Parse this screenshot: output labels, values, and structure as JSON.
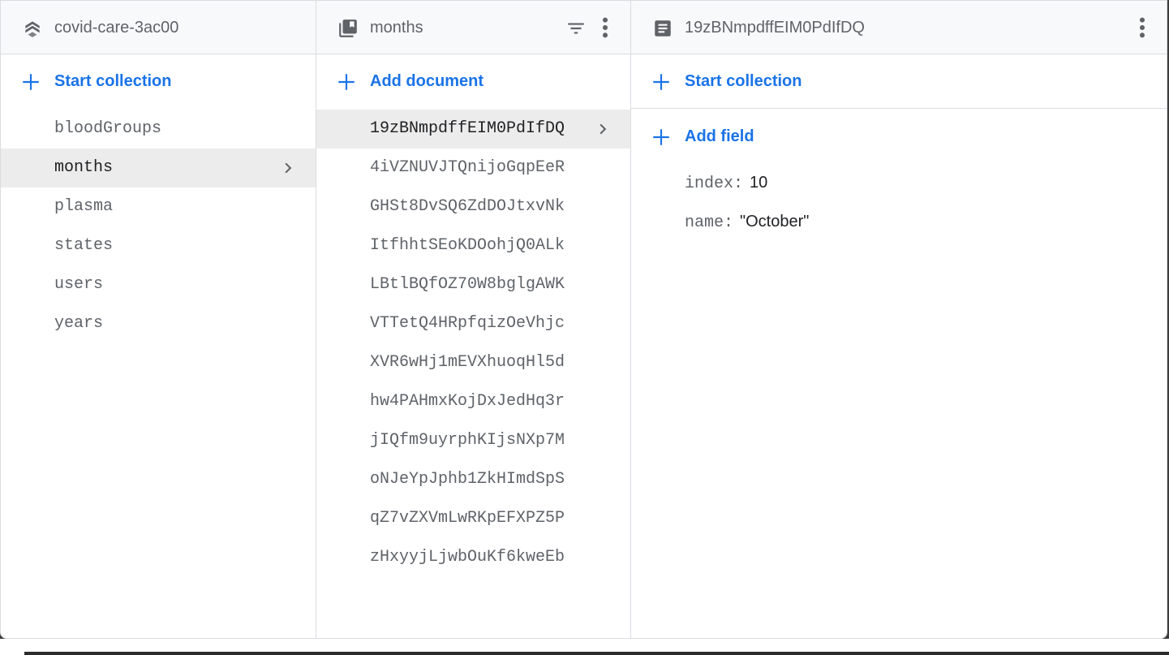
{
  "panel_root": {
    "title": "covid-care-3ac00",
    "action_label": "Start collection",
    "items": [
      "bloodGroups",
      "months",
      "plasma",
      "states",
      "users",
      "years"
    ],
    "selected_index": 1
  },
  "panel_collection": {
    "title": "months",
    "action_label": "Add document",
    "items": [
      "19zBNmpdffEIM0PdIfDQ",
      "4iVZNUVJTQnijoGqpEeR",
      "GHSt8DvSQ6ZdDOJtxvNk",
      "ItfhhtSEoKDOohjQ0ALk",
      "LBtlBQfOZ70W8bglgAWK",
      "VTTetQ4HRpfqizOeVhjc",
      "XVR6wHj1mEVXhuoqHl5d",
      "hw4PAHmxKojDxJedHq3r",
      "jIQfm9uyrphKIjsNXp7M",
      "oNJeYpJphb1ZkHImdSpS",
      "qZ7vZXVmLwRKpEFXPZ5P",
      "zHxyyjLjwbOuKf6kweEb"
    ],
    "selected_index": 0
  },
  "panel_document": {
    "title": "19zBNmpdffEIM0PdIfDQ",
    "start_collection_label": "Start collection",
    "add_field_label": "Add field",
    "fields": [
      {
        "key": "index:",
        "value": "10"
      },
      {
        "key": "name:",
        "value": "\"October\""
      }
    ]
  },
  "colors": {
    "accent": "#1a73e8",
    "header_bg": "#f8f9fa",
    "selected_bg": "#ececec",
    "muted_text": "#5f6368"
  },
  "icons": {
    "root_header": "firebase-stack-icon",
    "collection_header": "collection-icon",
    "document_header": "document-icon",
    "filter": "filter-icon",
    "more": "more-vert-icon",
    "add": "plus-icon",
    "selected": "chevron-right-icon"
  }
}
